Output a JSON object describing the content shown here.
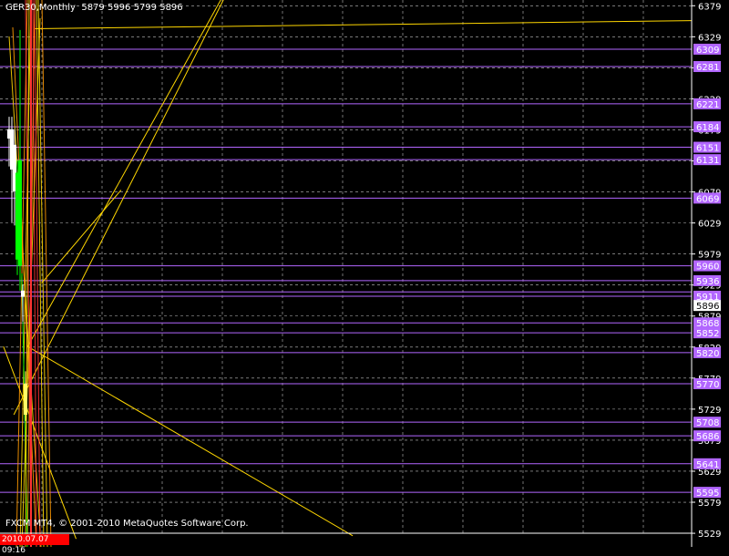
{
  "header": {
    "symbol": "GER30,Monthly",
    "ohlc": "5879 5996 5799 5896"
  },
  "footer": {
    "copyright": "FXCM MT4, © 2001-2010 MetaQuotes Software Corp.",
    "timestamp": "2010.07.07 09:16"
  },
  "colors": {
    "background": "#000000",
    "grid": "#ffffff",
    "axis_text": "#ffffff",
    "level_line": "#b266ff",
    "level_label_bg": "#b266ff",
    "price_tag_bg": "#ffffff",
    "trend_line": "#ffd700",
    "bull_candle": "#ffffff",
    "bear_candle": "#00ff00",
    "yellow_candle": "#ffff66",
    "orange_line": "#ff9900",
    "red_line": "#ff3333"
  },
  "chart_data": {
    "type": "candlestick",
    "instrument": "GER30",
    "timeframe": "Monthly",
    "current_price": 5896,
    "ylim": [
      5510,
      6400
    ],
    "y_tick_labels": [
      6379,
      6329,
      6279,
      6229,
      6179,
      6129,
      6079,
      6029,
      5979,
      5929,
      5879,
      5829,
      5779,
      5729,
      5679,
      5629,
      5579,
      5529
    ],
    "horizontal_levels": [
      6309,
      6281,
      6221,
      6184,
      6151,
      6131,
      6069,
      5960,
      5936,
      5918,
      5911,
      5868,
      5852,
      5820,
      5770,
      5708,
      5686,
      5641,
      5595
    ],
    "visible_level_labels": [
      6309,
      6281,
      6221,
      6184,
      6151,
      6131,
      6069,
      5960,
      5936,
      5911,
      5868,
      5852,
      5820,
      5770,
      5708,
      5686,
      5641,
      5595
    ],
    "grid": true,
    "candles": [
      {
        "open": 6165,
        "high": 6200,
        "low": 6120,
        "close": 6180,
        "color": "white"
      },
      {
        "open": 6180,
        "high": 6200,
        "low": 6030,
        "close": 6115,
        "color": "white"
      },
      {
        "open": 6155,
        "high": 6180,
        "low": 6025,
        "close": 6080,
        "color": "white"
      },
      {
        "open": 6110,
        "high": 6130,
        "low": 5945,
        "close": 5970,
        "color": "green"
      },
      {
        "open": 6130,
        "high": 6340,
        "low": 5920,
        "close": 5960,
        "color": "green"
      },
      {
        "open": 5910,
        "high": 5930,
        "low": 5870,
        "close": 5920,
        "color": "white"
      },
      {
        "open": 5770,
        "high": 5790,
        "low": 5710,
        "close": 5720,
        "color": "yellow"
      }
    ],
    "trend_lines": [
      {
        "from": [
          0.02,
          5720
        ],
        "to": [
          0.36,
          6470
        ],
        "color": "yellow"
      },
      {
        "from": [
          0.04,
          5830
        ],
        "to": [
          0.36,
          6470
        ],
        "color": "yellow"
      },
      {
        "from": [
          0.05,
          6342
        ],
        "to": [
          1.0,
          6355
        ],
        "color": "yellow"
      },
      {
        "from": [
          0.04,
          5830
        ],
        "to": [
          0.51,
          5525
        ],
        "color": "yellow"
      },
      {
        "from": [
          0.06,
          5932
        ],
        "to": [
          0.175,
          6082
        ],
        "color": "yellow"
      },
      {
        "from": [
          0.005,
          5830
        ],
        "to": [
          0.11,
          5520
        ],
        "color": "yellow"
      }
    ]
  }
}
